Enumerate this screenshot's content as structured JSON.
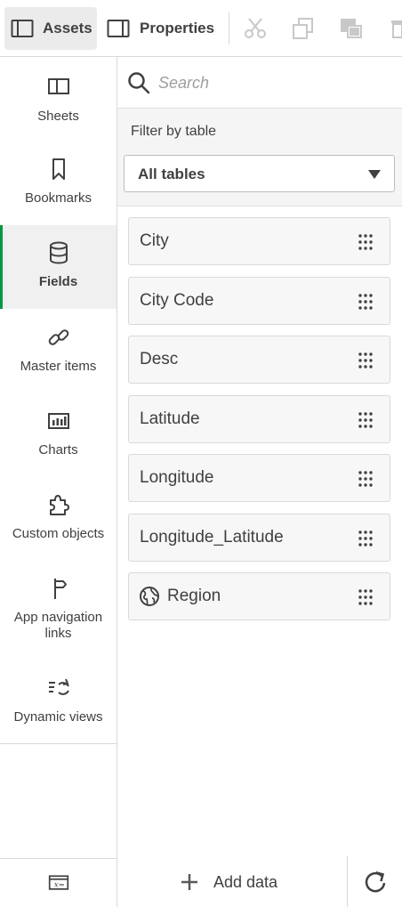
{
  "toolbar": {
    "assets_label": "Assets",
    "properties_label": "Properties",
    "cut_icon": "scissors-icon",
    "copy_icon": "copy-icon",
    "paste_icon": "paste-icon",
    "delete_icon": "trash-icon"
  },
  "nav": {
    "items": [
      {
        "label": "Sheets",
        "icon": "sheet-icon"
      },
      {
        "label": "Bookmarks",
        "icon": "bookmark-icon"
      },
      {
        "label": "Fields",
        "icon": "database-icon",
        "active": true
      },
      {
        "label": "Master items",
        "icon": "link-icon"
      },
      {
        "label": "Charts",
        "icon": "bar-chart-icon"
      },
      {
        "label": "Custom objects",
        "icon": "puzzle-icon"
      },
      {
        "label": "App navigation links",
        "icon": "signpost-icon"
      },
      {
        "label": "Dynamic views",
        "icon": "dynamic-view-icon"
      }
    ],
    "bottom_icon": "variable-icon"
  },
  "panel": {
    "search": {
      "placeholder": "Search",
      "value": ""
    },
    "filter": {
      "label": "Filter by table",
      "selected": "All tables"
    },
    "fields": [
      {
        "name": "City"
      },
      {
        "name": "City Code"
      },
      {
        "name": "Desc"
      },
      {
        "name": "Latitude"
      },
      {
        "name": "Longitude"
      },
      {
        "name": "Longitude_Latitude"
      },
      {
        "name": "Region",
        "icon": "globe-icon"
      }
    ],
    "add_data_label": "Add data",
    "reload_icon": "reload-icon"
  },
  "colors": {
    "accent": "#009845",
    "active_bg": "#f0f0f0",
    "text": "#404040",
    "disabled": "#c8c8c8"
  }
}
